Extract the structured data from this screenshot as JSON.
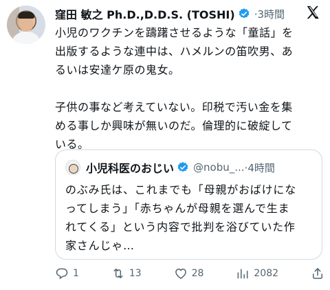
{
  "tweet": {
    "author_name": "窪田 敏之 Ph.D.,D.D.S. (TOSHI)",
    "separator_time": "·3時間",
    "paragraphs": [
      "小児のワクチンを躊躇させるような「童話」を\n出版するような連中は、ハメルンの笛吹男、あ\nるいは安達ケ原の鬼女。",
      "子供の事など考えていない。印税で汚い金を集\nめる事しか興味が無いのだ。倫理的に破綻して\nいる。"
    ]
  },
  "quote": {
    "name": "小児科医のおじい",
    "handle": "@nobu_...",
    "time": "·4時間",
    "text": "のぶみ氏は、これまでも「母親がおばけにな\nってしまう」「赤ちゃんが母親を選んで生ま\nれてくる」という内容で批判を浴びていた作\n家さんじゃ…"
  },
  "actions": {
    "reply_count": "1",
    "retweet_count": "13",
    "like_count": "28",
    "view_count": "2082"
  },
  "icons": {
    "verified": "verified-badge-icon",
    "x_logo": "x-logo-icon",
    "reply": "reply-icon",
    "retweet": "retweet-icon",
    "like": "heart-icon",
    "views": "views-chart-icon",
    "share": "share-icon"
  },
  "colors": {
    "text": "#0f1419",
    "secondary": "#536471",
    "verified": "#1d9bf0",
    "border": "#cfd9de"
  }
}
